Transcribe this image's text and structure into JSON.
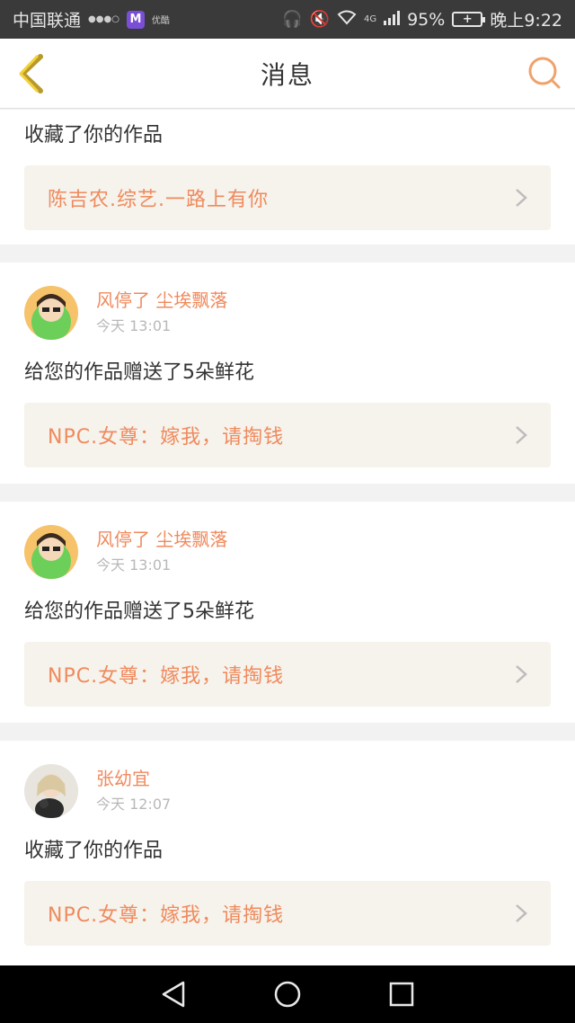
{
  "status_bar": {
    "carrier": "中国联通",
    "tiny1": "●●●○",
    "app_badge": "M",
    "tiny2": "优酷",
    "network": "4G",
    "battery": "95%",
    "time": "晚上9:22"
  },
  "header": {
    "title": "消息"
  },
  "messages": [
    {
      "text": "收藏了你的作品",
      "work_title": "陈吉农.综艺.一路上有你"
    },
    {
      "user_name": "风停了 尘埃飘落",
      "time": "今天 13:01",
      "text": "给您的作品赠送了5朵鲜花",
      "work_title": "NPC.女尊：嫁我，请掏钱"
    },
    {
      "user_name": "风停了 尘埃飘落",
      "time": "今天 13:01",
      "text": "给您的作品赠送了5朵鲜花",
      "work_title": "NPC.女尊：嫁我，请掏钱"
    },
    {
      "user_name": "张幼宜",
      "time": "今天 12:07",
      "text": "收藏了你的作品",
      "work_title": "NPC.女尊：嫁我，请掏钱"
    }
  ],
  "colors": {
    "accent": "#f08a5d",
    "status_bar": "#3a3a3a",
    "card_link_bg": "#f5f3ec"
  }
}
